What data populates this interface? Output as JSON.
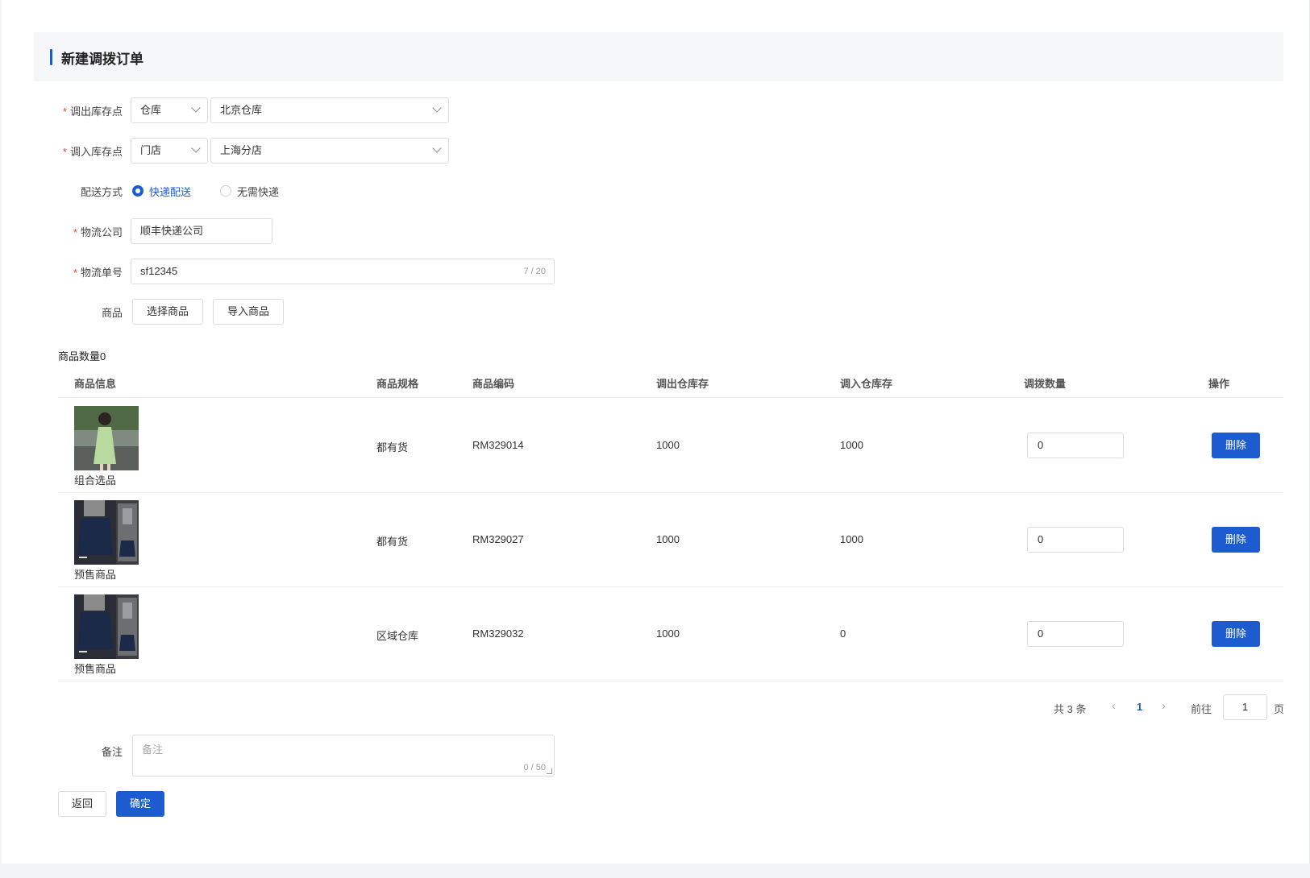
{
  "page_title": "新建调拨订单",
  "form": {
    "out_location": {
      "label": "调出库存点",
      "type": "仓库",
      "value": "北京仓库"
    },
    "in_location": {
      "label": "调入库存点",
      "type": "门店",
      "value": "上海分店"
    },
    "delivery": {
      "label": "配送方式",
      "options": [
        "快递配送",
        "无需快递"
      ],
      "selected": "快递配送"
    },
    "logistics_company": {
      "label": "物流公司",
      "value": "顺丰快递公司"
    },
    "tracking_no": {
      "label": "物流单号",
      "value": "sf12345",
      "counter": "7 / 20"
    },
    "goods": {
      "label": "商品",
      "select_button": "选择商品",
      "import_button": "导入商品"
    }
  },
  "table": {
    "count_label": "商品数量0",
    "columns": [
      "商品信息",
      "商品规格",
      "商品编码",
      "调出仓库存",
      "调入仓库存",
      "调拨数量",
      "操作"
    ],
    "rows": [
      {
        "name": "组合选品",
        "spec": "都有货",
        "code": "RM329014",
        "out_stock": "1000",
        "in_stock": "1000",
        "qty": "0",
        "action": "删除",
        "thumb": "green-dress"
      },
      {
        "name": "预售商品",
        "spec": "都有货",
        "code": "RM329027",
        "out_stock": "1000",
        "in_stock": "1000",
        "qty": "0",
        "action": "删除",
        "thumb": "navy-skirt"
      },
      {
        "name": "预售商品",
        "spec": "区域仓库",
        "code": "RM329032",
        "out_stock": "1000",
        "in_stock": "0",
        "qty": "0",
        "action": "删除",
        "thumb": "navy-skirt"
      }
    ]
  },
  "pagination": {
    "total": "共 3 条",
    "current": "1",
    "goto_label": "前往",
    "goto_value": "1",
    "page_suffix": "页"
  },
  "remark": {
    "label": "备注",
    "placeholder": "备注",
    "counter": "0 / 50"
  },
  "footer": {
    "back": "返回",
    "confirm": "确定"
  },
  "colors": {
    "primary": "#1d5bd1",
    "required": "#e0463a"
  }
}
